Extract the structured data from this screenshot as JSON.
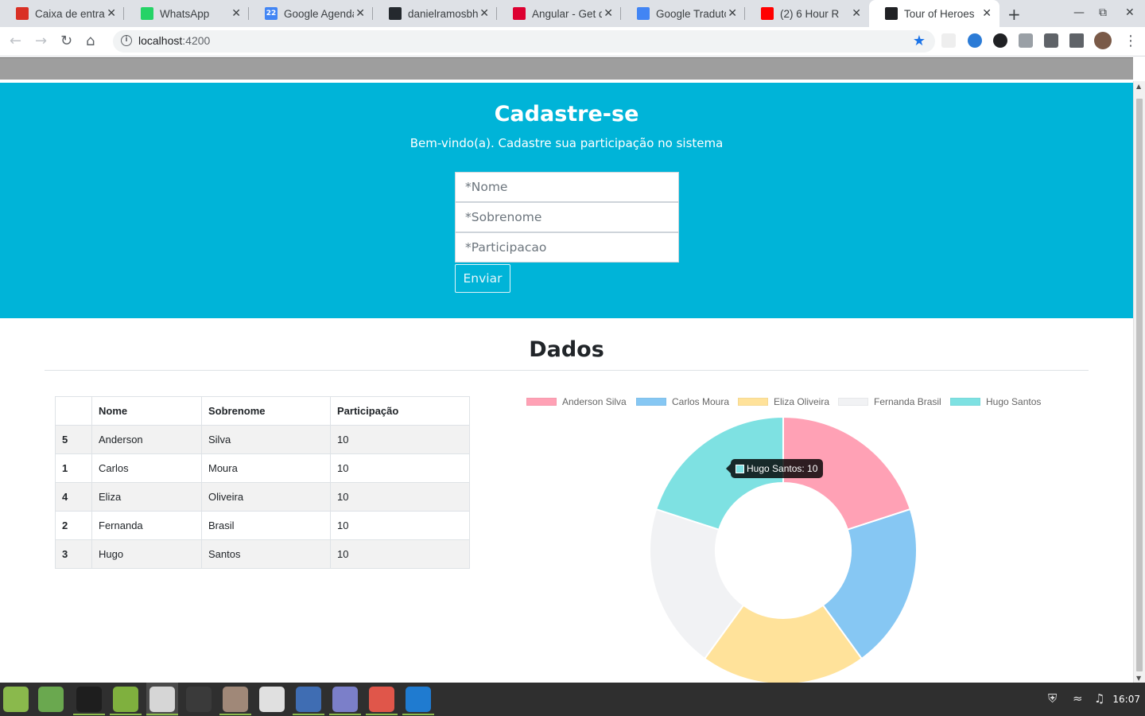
{
  "browser": {
    "tabs": [
      {
        "title": "Caixa de entrada",
        "icon": "gmail-icon",
        "color": "#d93025"
      },
      {
        "title": "WhatsApp",
        "icon": "whatsapp-icon",
        "color": "#25d366"
      },
      {
        "title": "Google Agenda",
        "icon": "calendar-icon",
        "color": "#4285f4",
        "badge": "22"
      },
      {
        "title": "danielramosbh",
        "icon": "github-icon",
        "color": "#24292e"
      },
      {
        "title": "Angular - Get d",
        "icon": "angular-icon",
        "color": "#dd0031"
      },
      {
        "title": "Google Tradutor",
        "icon": "translate-icon",
        "color": "#4285f4"
      },
      {
        "title": "(2) 6 Hour R",
        "icon": "youtube-icon",
        "color": "#ff0000"
      },
      {
        "title": "Tour of Heroes",
        "icon": "angular-icon",
        "color": "#202124",
        "active": true
      }
    ],
    "url_host": "localhost",
    "url_port": ":4200"
  },
  "hero": {
    "title": "Cadastre-se",
    "subtitle": "Bem-vindo(a). Cadastre sua participação no sistema",
    "fields": {
      "nome_placeholder": "*Nome",
      "sobrenome_placeholder": "*Sobrenome",
      "participacao_placeholder": "*Participacao"
    },
    "submit_label": "Enviar"
  },
  "dados": {
    "title": "Dados",
    "table": {
      "headers": [
        "",
        "Nome",
        "Sobrenome",
        "Participação"
      ],
      "rows": [
        [
          "5",
          "Anderson",
          "Silva",
          "10"
        ],
        [
          "1",
          "Carlos",
          "Moura",
          "10"
        ],
        [
          "4",
          "Eliza",
          "Oliveira",
          "10"
        ],
        [
          "2",
          "Fernanda",
          "Brasil",
          "10"
        ],
        [
          "3",
          "Hugo",
          "Santos",
          "10"
        ]
      ]
    },
    "tooltip": "Hugo Santos: 10"
  },
  "chart_data": {
    "type": "pie",
    "variant": "doughnut",
    "labels": [
      "Anderson Silva",
      "Carlos Moura",
      "Eliza Oliveira",
      "Fernanda Brasil",
      "Hugo Santos"
    ],
    "values": [
      10,
      10,
      10,
      10,
      10
    ],
    "colors": [
      "#ffa1b5",
      "#86c7f3",
      "#ffe29a",
      "#f1f2f4",
      "#7ee1e2"
    ],
    "legend": "top"
  },
  "taskbar": {
    "clock": "16:07",
    "apps": [
      "mint-menu-icon",
      "show-desktop-icon",
      "terminal-icon",
      "files-icon",
      "chrome-icon",
      "calculator-icon",
      "camera-app-icon",
      "webcam-icon",
      "screenshot-icon",
      "text-editor-icon",
      "image-viewer-icon",
      "vscode-icon"
    ]
  }
}
